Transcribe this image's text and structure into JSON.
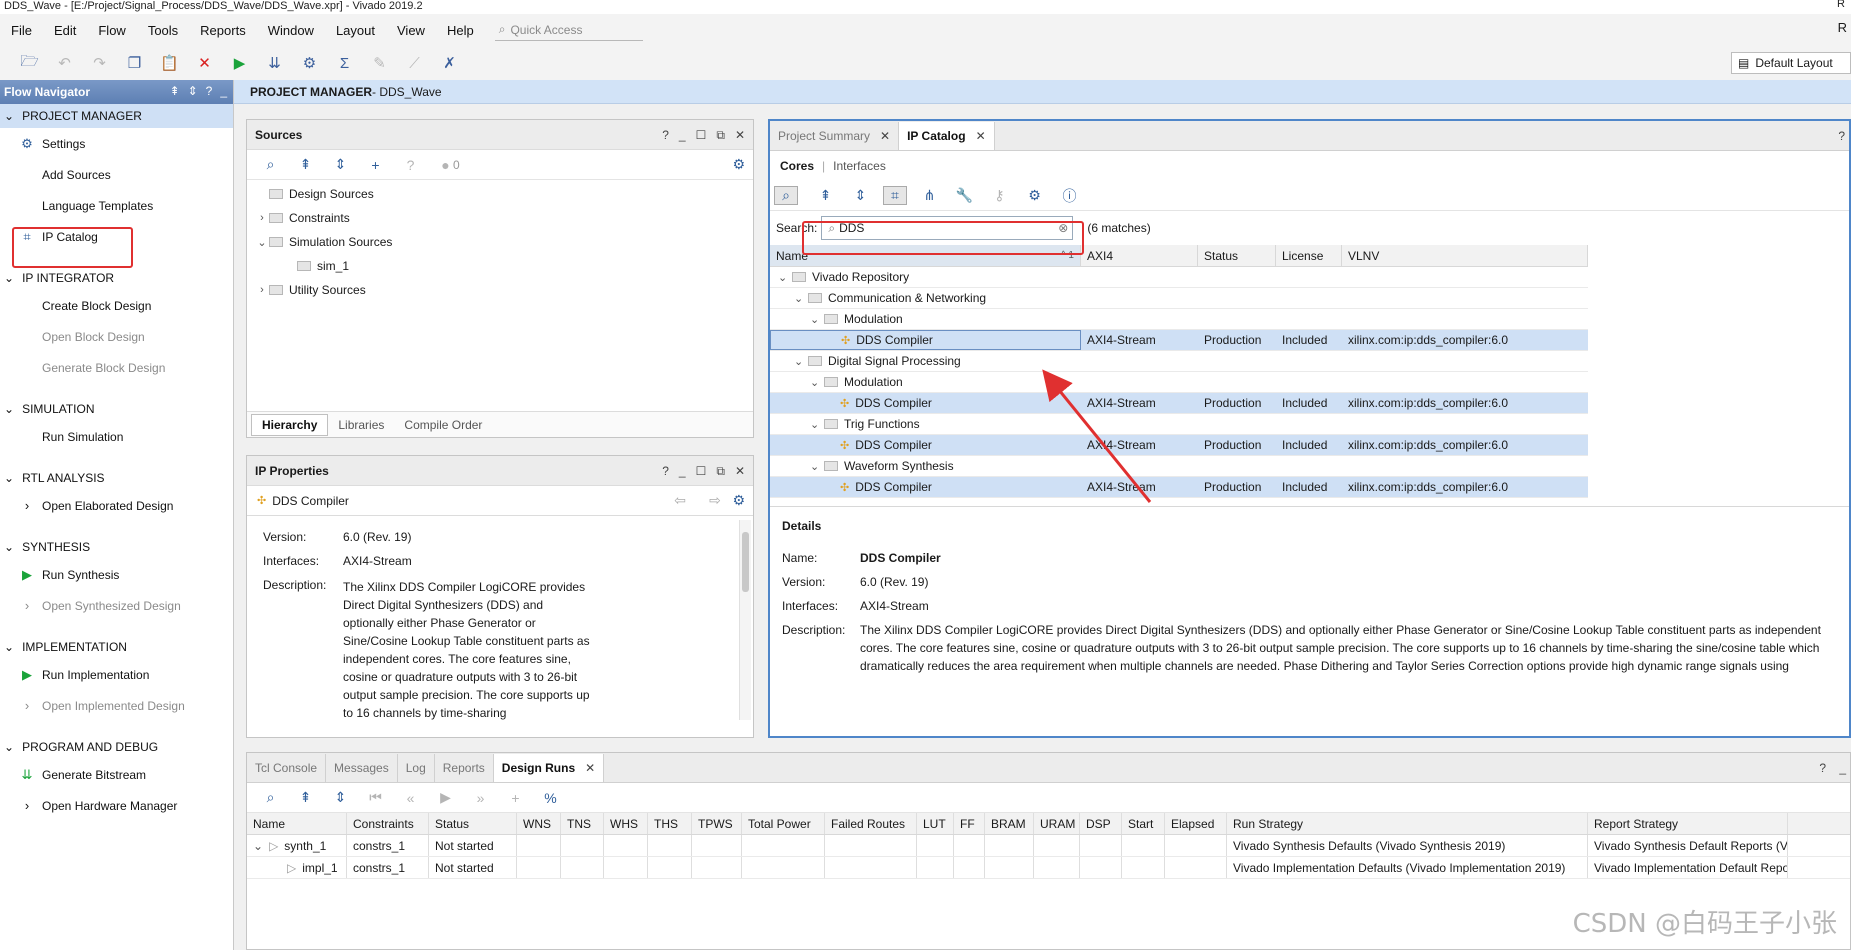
{
  "window": {
    "title": "DDS_Wave - [E:/Project/Signal_Process/DDS_Wave/DDS_Wave.xpr] - Vivado 2019.2",
    "right_edge": "R"
  },
  "menu": {
    "items": [
      "File",
      "Edit",
      "Flow",
      "Tools",
      "Reports",
      "Window",
      "Layout",
      "View",
      "Help"
    ],
    "quick_access_placeholder": "Quick Access"
  },
  "toolbar": {
    "layout_label": "Default Layout"
  },
  "flow_navigator": {
    "title": "Flow Navigator",
    "sections": [
      {
        "label": "PROJECT MANAGER",
        "items": [
          {
            "label": "Settings",
            "icon": "gear-icon"
          },
          {
            "label": "Add Sources",
            "icon": ""
          },
          {
            "label": "Language Templates",
            "icon": ""
          },
          {
            "label": "IP Catalog",
            "icon": "ip-chip-icon"
          }
        ]
      },
      {
        "label": "IP INTEGRATOR",
        "items": [
          {
            "label": "Create Block Design"
          },
          {
            "label": "Open Block Design"
          },
          {
            "label": "Generate Block Design"
          }
        ]
      },
      {
        "label": "SIMULATION",
        "items": [
          {
            "label": "Run Simulation"
          }
        ]
      },
      {
        "label": "RTL ANALYSIS",
        "items": [
          {
            "label": "Open Elaborated Design"
          }
        ]
      },
      {
        "label": "SYNTHESIS",
        "items": [
          {
            "label": "Run Synthesis"
          },
          {
            "label": "Open Synthesized Design"
          }
        ]
      },
      {
        "label": "IMPLEMENTATION",
        "items": [
          {
            "label": "Run Implementation"
          },
          {
            "label": "Open Implemented Design"
          }
        ]
      },
      {
        "label": "PROGRAM AND DEBUG",
        "items": [
          {
            "label": "Generate Bitstream"
          },
          {
            "label": "Open Hardware Manager"
          }
        ]
      }
    ]
  },
  "main_header": {
    "prefix": "PROJECT MANAGER",
    "project": " - DDS_Wave"
  },
  "sources": {
    "title": "Sources",
    "badge_count": "0",
    "tree": [
      "Design Sources",
      "Constraints",
      "Simulation Sources",
      "sim_1",
      "Utility Sources"
    ],
    "tabs": [
      "Hierarchy",
      "Libraries",
      "Compile Order"
    ]
  },
  "ip_properties": {
    "title": "IP Properties",
    "name": "DDS Compiler",
    "version_label": "Version:",
    "version": "6.0 (Rev. 19)",
    "interfaces_label": "Interfaces:",
    "interfaces": "AXI4-Stream",
    "description_label": "Description:",
    "description": "The Xilinx DDS Compiler LogiCORE provides Direct Digital Synthesizers (DDS) and optionally either Phase Generator or Sine/Cosine Lookup Table constituent parts as independent cores. The core features sine, cosine or quadrature outputs with 3 to 26-bit output sample precision. The core supports up to 16 channels by time-sharing"
  },
  "ip_catalog": {
    "tabs": [
      "Project Summary",
      "IP Catalog"
    ],
    "subtabs": [
      "Cores",
      "Interfaces"
    ],
    "search_label": "Search:",
    "search_value": "DDS",
    "matches": "(6 matches)",
    "columns": [
      "Name",
      "AXI4",
      "Status",
      "License",
      "VLNV"
    ],
    "sort_indicator": "^ 1",
    "rows": [
      {
        "level": 0,
        "type": "folder",
        "name": "Vivado Repository"
      },
      {
        "level": 1,
        "type": "folder",
        "name": "Communication & Networking"
      },
      {
        "level": 2,
        "type": "folder",
        "name": "Modulation"
      },
      {
        "level": 3,
        "type": "ip",
        "name": "DDS Compiler",
        "axi": "AXI4-Stream",
        "status": "Production",
        "license": "Included",
        "vlnv": "xilinx.com:ip:dds_compiler:6.0",
        "selected": true
      },
      {
        "level": 1,
        "type": "folder",
        "name": "Digital Signal Processing"
      },
      {
        "level": 2,
        "type": "folder",
        "name": "Modulation"
      },
      {
        "level": 3,
        "type": "ip",
        "name": "DDS Compiler",
        "axi": "AXI4-Stream",
        "status": "Production",
        "license": "Included",
        "vlnv": "xilinx.com:ip:dds_compiler:6.0",
        "selected": true
      },
      {
        "level": 2,
        "type": "folder",
        "name": "Trig Functions"
      },
      {
        "level": 3,
        "type": "ip",
        "name": "DDS Compiler",
        "axi": "AXI4-Stream",
        "status": "Production",
        "license": "Included",
        "vlnv": "xilinx.com:ip:dds_compiler:6.0",
        "selected": true
      },
      {
        "level": 2,
        "type": "folder",
        "name": "Waveform Synthesis"
      },
      {
        "level": 3,
        "type": "ip",
        "name": "DDS Compiler",
        "axi": "AXI4-Stream",
        "status": "Production",
        "license": "Included",
        "vlnv": "xilinx.com:ip:dds_compiler:6.0",
        "selected": true
      }
    ],
    "details": {
      "title": "Details",
      "name_label": "Name:",
      "name": "DDS Compiler",
      "version_label": "Version:",
      "version": "6.0 (Rev. 19)",
      "interfaces_label": "Interfaces:",
      "interfaces": "AXI4-Stream",
      "description_label": "Description:",
      "description": "The Xilinx DDS Compiler LogiCORE provides Direct Digital Synthesizers (DDS) and optionally either Phase Generator or Sine/Cosine Lookup Table constituent parts as independent cores. The core features sine, cosine or quadrature outputs with 3 to 26-bit output sample precision. The core supports up to 16 channels by time-sharing the sine/cosine table which dramatically reduces the area requirement when multiple channels are needed. Phase Dithering and Taylor Series Correction options provide high dynamic range signals using"
    }
  },
  "design_runs": {
    "tabs": [
      "Tcl Console",
      "Messages",
      "Log",
      "Reports",
      "Design Runs"
    ],
    "columns": [
      "Name",
      "Constraints",
      "Status",
      "WNS",
      "TNS",
      "WHS",
      "THS",
      "TPWS",
      "Total Power",
      "Failed Routes",
      "LUT",
      "FF",
      "BRAM",
      "URAM",
      "DSP",
      "Start",
      "Elapsed",
      "Run Strategy",
      "Report Strategy"
    ],
    "rows": [
      {
        "name": "synth_1",
        "constraints": "constrs_1",
        "status": "Not started",
        "run_strategy": "Vivado Synthesis Defaults (Vivado Synthesis 2019)",
        "report_strategy": "Vivado Synthesis Default Reports (Vivado"
      },
      {
        "name": "impl_1",
        "constraints": "constrs_1",
        "status": "Not started",
        "run_strategy": "Vivado Implementation Defaults (Vivado Implementation 2019)",
        "report_strategy": "Vivado Implementation Default Reports (V"
      }
    ]
  },
  "watermark": "CSDN @白码王子小张"
}
